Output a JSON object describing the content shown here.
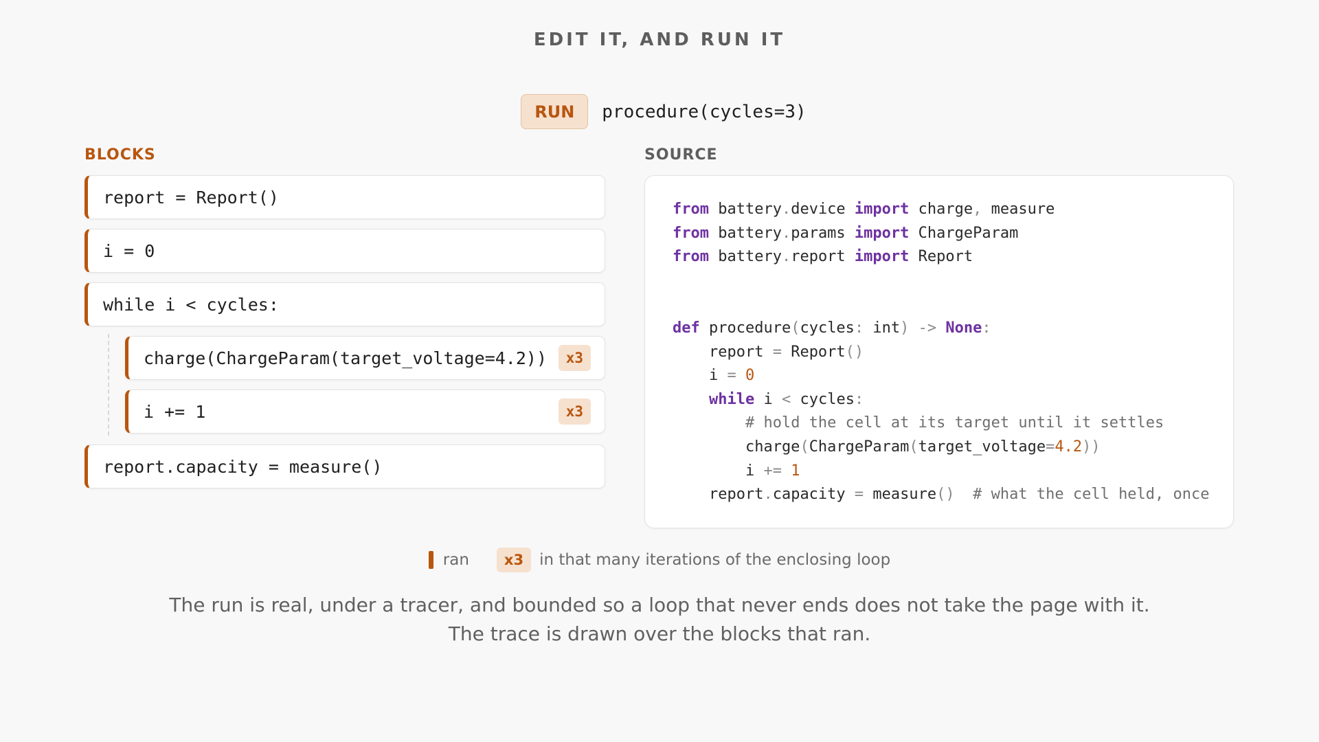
{
  "title": "EDIT IT, AND RUN IT",
  "run": {
    "button_label": "RUN",
    "call": "procedure(cycles=3)"
  },
  "blocks": {
    "label": "BLOCKS",
    "items": [
      {
        "code": "report = Report()",
        "ran": true,
        "badge": ""
      },
      {
        "code": "i = 0",
        "ran": true,
        "badge": ""
      },
      {
        "code": "while i < cycles:",
        "ran": true,
        "badge": ""
      },
      {
        "code": "charge(ChargeParam(target_voltage=4.2))",
        "ran": true,
        "badge": "x3"
      },
      {
        "code": "i += 1",
        "ran": true,
        "badge": "x3"
      },
      {
        "code": "report.capacity = measure()",
        "ran": true,
        "badge": ""
      }
    ]
  },
  "source": {
    "label": "SOURCE",
    "lines": [
      "from battery.device import charge, measure",
      "from battery.params import ChargeParam",
      "from battery.report import Report",
      "",
      "",
      "def procedure(cycles: int) -> None:",
      "    report = Report()",
      "    i = 0",
      "    while i < cycles:",
      "        # hold the cell at its target until it settles",
      "        charge(ChargeParam(target_voltage=4.2))",
      "        i += 1",
      "    report.capacity = measure()  # what the cell held, once"
    ]
  },
  "legend": {
    "ran_label": "ran",
    "badge_label": "x3",
    "badge_text": "in that many iterations of the enclosing loop"
  },
  "footnote": "The run is real, under a tracer, and bounded so a loop that never ends does not take the page with it. The trace is drawn over the blocks that ran.",
  "colors": {
    "accent": "#b8560f",
    "badge_bg": "#f6e1cf",
    "keyword": "#6e32a0"
  }
}
